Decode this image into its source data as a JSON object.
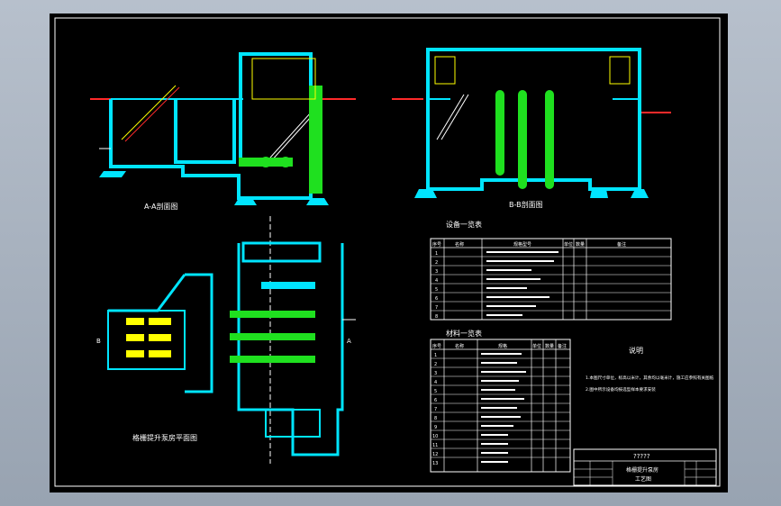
{
  "drawing": {
    "views": {
      "section_aa": "A-A剖面图",
      "section_bb": "B-B剖面图",
      "plan": "格栅提升泵房平面图"
    },
    "section_markers": [
      "A",
      "B"
    ],
    "equipment_table": {
      "title": "设备一览表",
      "headers": [
        "序号",
        "名称",
        "规格型号",
        "单位",
        "数量",
        "备注"
      ],
      "row_numbers": [
        "1",
        "2",
        "3",
        "4",
        "5",
        "6",
        "7",
        "8"
      ]
    },
    "materials_table": {
      "title": "材料一览表",
      "headers": [
        "序号",
        "名称",
        "规格",
        "单位",
        "数量",
        "备注"
      ],
      "row_numbers": [
        "1",
        "2",
        "3",
        "4",
        "5",
        "6",
        "7",
        "8",
        "9",
        "10",
        "11",
        "12",
        "13"
      ]
    },
    "notes": {
      "title": "说明",
      "lines": [
        "1.本图尺寸单位，标高以米计，其余均以毫米计，施工应参照有关图纸",
        "2.图中所示设备均按选型样本要求安装"
      ]
    },
    "title_block": {
      "header": "?????",
      "drawing_name_line1": "格栅提升泵房",
      "drawing_name_line2": "工艺图"
    }
  },
  "colors": {
    "structure": "#00e5ff",
    "equipment": "#1fe01f",
    "text": "#ffffff",
    "hatch": "#ff2a2a",
    "annotation": "#ffff00",
    "background": "#000000"
  }
}
